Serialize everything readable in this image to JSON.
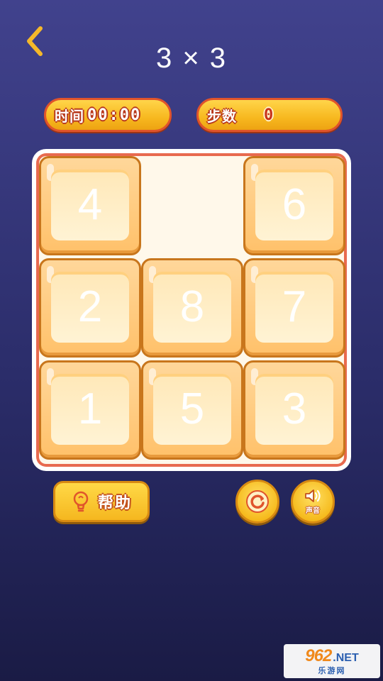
{
  "header": {
    "back_icon": "chevron-left-icon",
    "title": "3 × 3"
  },
  "stats": {
    "timer_label": "时间",
    "timer_value": "00:00",
    "steps_label": "步数",
    "steps_value": "0"
  },
  "board": {
    "size": 3,
    "tiles": [
      {
        "label": "4"
      },
      null,
      {
        "label": "6"
      },
      {
        "label": "2"
      },
      {
        "label": "8"
      },
      {
        "label": "7"
      },
      {
        "label": "1"
      },
      {
        "label": "5"
      },
      {
        "label": "3"
      }
    ]
  },
  "controls": {
    "help_label": "帮助",
    "help_icon": "lightbulb-icon",
    "refresh_icon": "refresh-icon",
    "sound_icon": "speaker-icon",
    "sound_label": "声音"
  },
  "watermark": {
    "number": "962",
    "suffix": ".NET",
    "caption": "乐游网"
  },
  "colors": {
    "accent_yellow": "#f7b81f",
    "border_red": "#e0542b",
    "background_top": "#41428d",
    "background_bottom": "#1a1b45"
  }
}
